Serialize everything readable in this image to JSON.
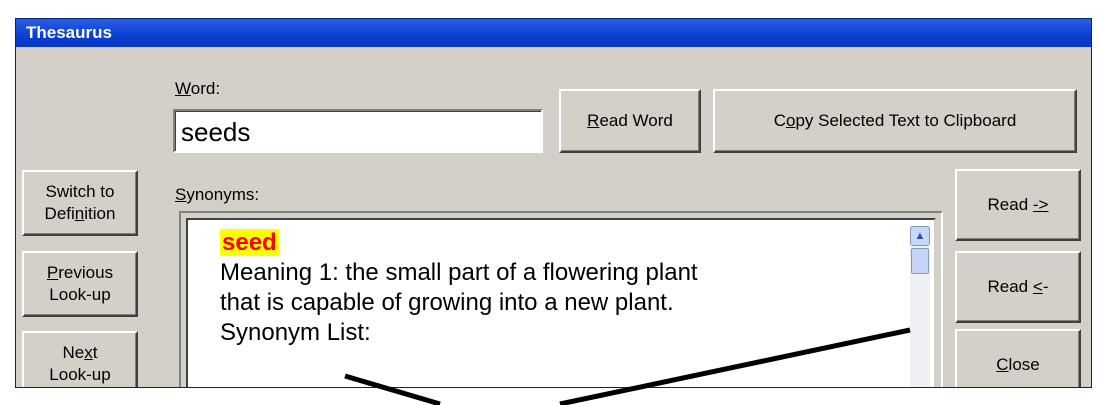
{
  "window": {
    "title": "Thesaurus"
  },
  "word": {
    "label_pre": "",
    "label_u": "W",
    "label_post": "ord:",
    "value": "seeds"
  },
  "buttons": {
    "read_word": {
      "pre": "",
      "u": "R",
      "post": "ead Word"
    },
    "copy": {
      "pre": "C",
      "u": "o",
      "post": "py Selected Text to Clipboard"
    },
    "switch": {
      "line1": "Switch to",
      "line2_pre": "Defi",
      "line2_u": "n",
      "line2_post": "ition"
    },
    "previous": {
      "line1_pre": "",
      "line1_u": "P",
      "line1_post": "revious",
      "line2": "Look-up"
    },
    "next": {
      "line1_pre": "Ne",
      "line1_u": "x",
      "line1_post": "t",
      "line2": "Look-up"
    },
    "read_forward": {
      "pre": "Read ",
      "u": "->",
      "post": ""
    },
    "read_back": {
      "pre": "Read ",
      "u": "<",
      "post": "-"
    },
    "close": {
      "pre": "",
      "u": "C",
      "post": "lose"
    }
  },
  "synonyms": {
    "label_pre": "",
    "label_u": "S",
    "label_post": "ynonyms:",
    "headword": "seed",
    "lines": [
      "Meaning 1: the small part of a flowering plant",
      "that is capable of growing into a new plant.",
      "Synonym List:"
    ]
  },
  "icons": {
    "scroll_up": "scroll-up-arrow-icon",
    "scroll_down": "scroll-down-arrow-icon",
    "annotation": "annotation-arrows"
  },
  "colors": {
    "title_bar": "#0b3fd0",
    "face": "#d4d0c8",
    "highlight_bg": "#ffff00",
    "highlight_text": "#ff0000"
  }
}
